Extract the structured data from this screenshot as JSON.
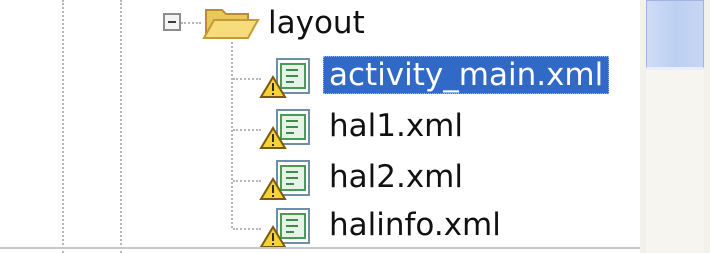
{
  "tree": {
    "folder": {
      "label": "layout",
      "icon": "open-folder-icon",
      "expanded": true
    },
    "files": [
      {
        "label": "activity_main.xml",
        "icon": "xml-file-warning-icon",
        "selected": true
      },
      {
        "label": "hal1.xml",
        "icon": "xml-file-warning-icon",
        "selected": false
      },
      {
        "label": "hal2.xml",
        "icon": "xml-file-warning-icon",
        "selected": false
      },
      {
        "label": "halinfo.xml",
        "icon": "xml-file-warning-icon",
        "selected": false
      }
    ]
  },
  "colors": {
    "selection": "#3169c6",
    "selection_text": "#ffffff",
    "scroll_thumb": "#bdd0f2"
  }
}
